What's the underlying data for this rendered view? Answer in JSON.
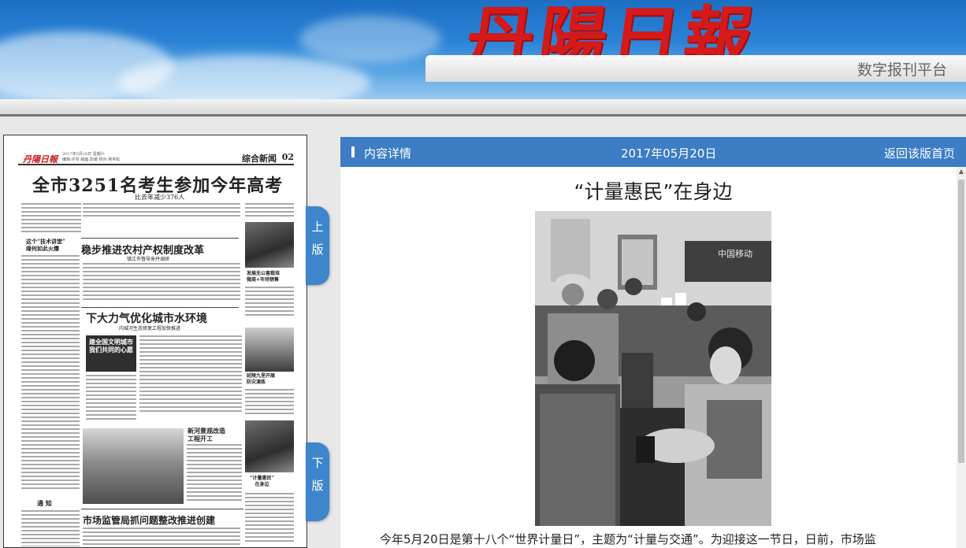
{
  "header": {
    "logo_text": "丹陽日報",
    "platform_label": "数字报刊平台"
  },
  "newspaper": {
    "masthead": "丹陽日報",
    "date_line": "2017年5月20日 星期六",
    "editor_line": "编辑:许琴 版面:彭媛 校对:吴韦松",
    "section": "综合新闻",
    "page_no": "02",
    "headline_main": "全市3251名考生参加今年高考",
    "headline_main_sub": "比去年减少376人",
    "headline_2": "稳步推进农村产权制度改革",
    "headline_2_sub": "镇江市督导来丹调研",
    "headline_3": "下大力气优化城市水环境",
    "headline_3_sub": "内城河生态修复工程加快推进",
    "headline_4_line1": "这个“技术讲堂”",
    "headline_4_line2": "缘何如此火爆",
    "banner_image_text": "建全国文明城市 我们共同的心愿",
    "headline_5_line1": "新河景观改造",
    "headline_5_line2": "工程开工",
    "headline_6": "市场监管局抓问题整改推进创建",
    "caption_1_line1": "发展无公害栽培",
    "caption_1_line2": "微商+市场销售",
    "caption_2_line1": "延陵九里开展",
    "caption_2_line2": "防灾演练",
    "caption_3_line1": "“计量惠民”",
    "caption_3_line2": "在身边",
    "notice_title": "通  知"
  },
  "nav": {
    "prev_page_char1": "上",
    "prev_page_char2": "版",
    "next_page_char1": "下",
    "next_page_char2": "版"
  },
  "content": {
    "section_label": "内容详情",
    "date": "2017年05月20日",
    "back_link": "返回该版首页",
    "article_title": "“计量惠民”在身边",
    "photo_sign_text": "中国移动",
    "article_first_line": "今年5月20日是第十八个“世界计量日”，主题为“计量与交通”。为迎接这一节日，日前，市场监"
  }
}
